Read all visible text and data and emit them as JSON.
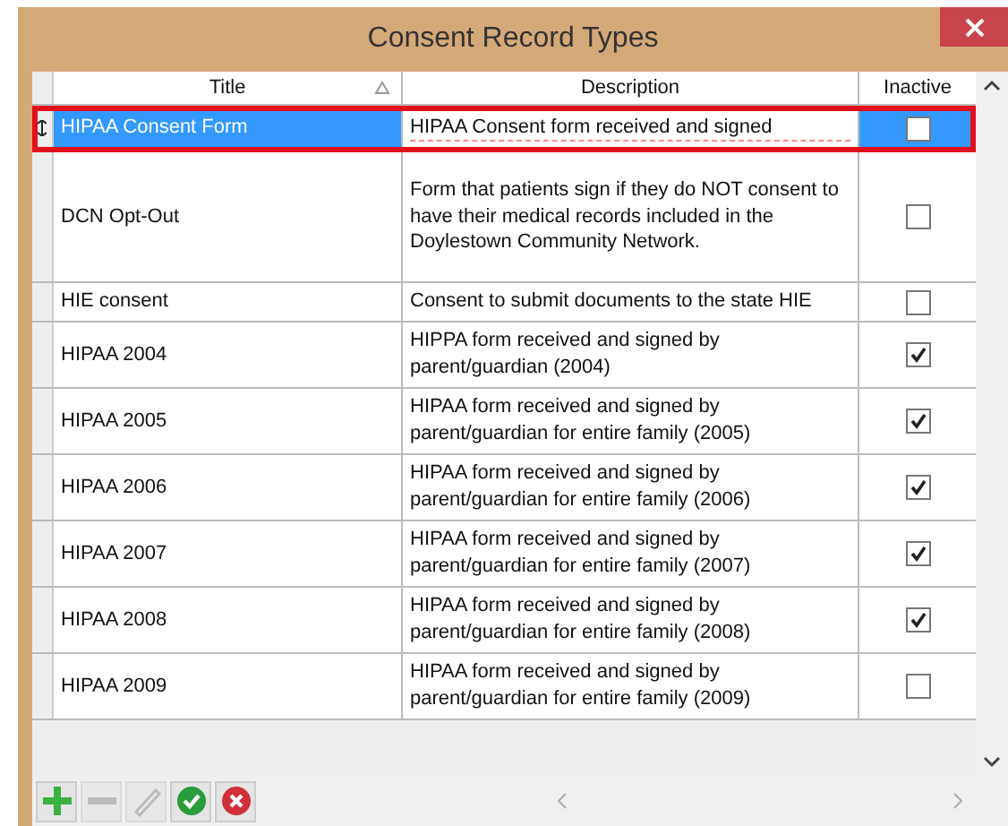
{
  "window": {
    "title": "Consent Record Types"
  },
  "table": {
    "columns": [
      {
        "label": "Title",
        "sorted": true
      },
      {
        "label": "Description",
        "sorted": false
      },
      {
        "label": "Inactive",
        "sorted": false
      }
    ],
    "rows": [
      {
        "title": "HIPAA Consent Form",
        "description": "HIPAA Consent form received and signed",
        "inactive": false,
        "selected": true,
        "editing": true
      },
      {
        "title": "DCN Opt-Out",
        "description": "Form that patients sign if they do NOT consent to have their medical records included in the Doylestown Community Network.",
        "inactive": false,
        "selected": false,
        "editing": false
      },
      {
        "title": "HIE consent",
        "description": "Consent to submit documents to the state HIE",
        "inactive": false,
        "selected": false,
        "editing": false
      },
      {
        "title": "HIPAA 2004",
        "description": "HIPPA form received and signed by parent/guardian (2004)",
        "inactive": true,
        "selected": false,
        "editing": false
      },
      {
        "title": "HIPAA 2005",
        "description": "HIPAA form received and signed by parent/guardian for entire family (2005)",
        "inactive": true,
        "selected": false,
        "editing": false
      },
      {
        "title": "HIPAA 2006",
        "description": "HIPAA form received and signed by parent/guardian for entire family (2006)",
        "inactive": true,
        "selected": false,
        "editing": false
      },
      {
        "title": "HIPAA 2007",
        "description": "HIPAA form received and signed by parent/guardian for entire family (2007)",
        "inactive": true,
        "selected": false,
        "editing": false
      },
      {
        "title": "HIPAA 2008",
        "description": "HIPAA form received and signed by parent/guardian for entire family (2008)",
        "inactive": true,
        "selected": false,
        "editing": false
      },
      {
        "title": "HIPAA 2009",
        "description": "HIPAA form received and signed by parent/guardian for entire family (2009)",
        "inactive": false,
        "selected": false,
        "editing": false
      }
    ]
  },
  "toolbar": [
    {
      "kind": "add",
      "disabled": false
    },
    {
      "kind": "remove",
      "disabled": true
    },
    {
      "kind": "edit",
      "disabled": true
    },
    {
      "kind": "accept",
      "disabled": false
    },
    {
      "kind": "cancel",
      "disabled": false
    }
  ]
}
